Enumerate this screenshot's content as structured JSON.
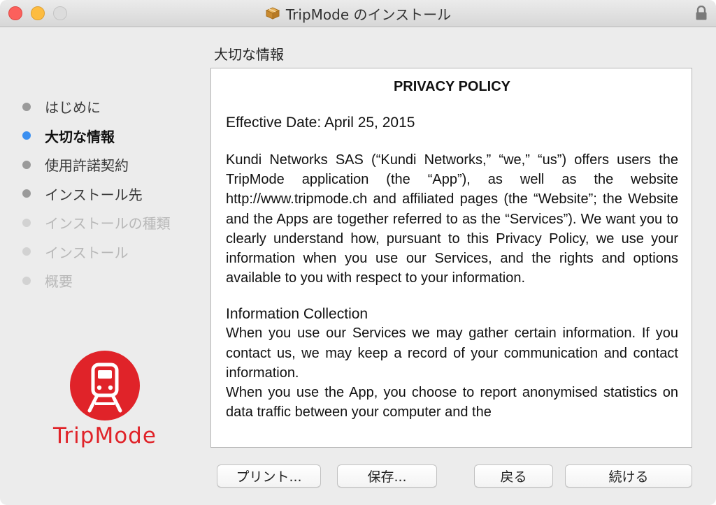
{
  "window": {
    "title": "TripMode のインストール"
  },
  "sidebar": {
    "steps": [
      {
        "label": "はじめに",
        "state": "done"
      },
      {
        "label": "大切な情報",
        "state": "current"
      },
      {
        "label": "使用許諾契約",
        "state": "done"
      },
      {
        "label": "インストール先",
        "state": "done"
      },
      {
        "label": "インストールの種類",
        "state": "pending"
      },
      {
        "label": "インストール",
        "state": "pending"
      },
      {
        "label": "概要",
        "state": "pending"
      }
    ],
    "logo_text": "TripMode"
  },
  "main": {
    "section_title": "大切な情報",
    "document": {
      "heading": "PRIVACY POLICY",
      "effective_date": "Effective Date: April 25, 2015",
      "intro": "Kundi Networks SAS (“Kundi Networks,” “we,” “us”) offers users the TripMode application (the “App”), as well as the website http://www.tripmode.ch and affiliated pages (the “Website”; the Website and the Apps are together referred to as the “Services”). We want you to clearly understand how, pursuant to this Privacy Policy, we use your information when you use our Services, and the rights and options available to you with respect to your information.",
      "section_heading": "Information Collection",
      "section_para_1": "When you use our Services we may gather certain information. If you contact us, we may keep a record of your communication and contact information.",
      "section_para_2": "When you use the App, you choose to report anonymised statistics on data traffic between your computer and the"
    }
  },
  "buttons": {
    "print": "プリント...",
    "save": "保存...",
    "back": "戻る",
    "continue": "続ける"
  },
  "colors": {
    "brand_red": "#e02329",
    "current_step_dot": "#3a8ff0",
    "done_step_dot": "#9a9a9a",
    "pending_step_dot": "#d2d2d2"
  }
}
